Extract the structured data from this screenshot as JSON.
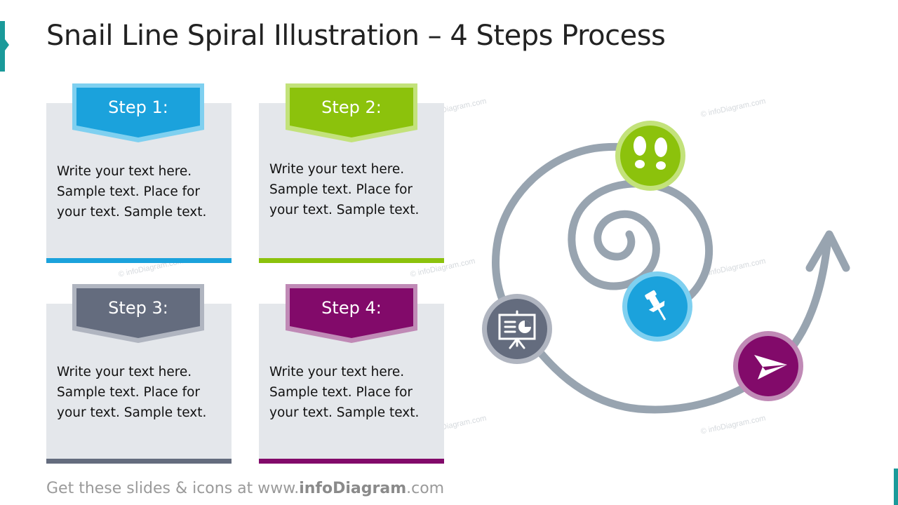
{
  "title": "Snail Line Spiral Illustration – 4 Steps Process",
  "steps": [
    {
      "label": "Step 1:",
      "text_lines": [
        "Write your text here.",
        "Sample text. Place for",
        "your text. Sample text."
      ],
      "color": "#1ba2dc",
      "border_color": "#7fd0f0",
      "icon": "pushpin-icon"
    },
    {
      "label": "Step 2:",
      "text_lines": [
        "Write your text here.",
        "Sample text. Place for",
        "your text. Sample text."
      ],
      "color": "#8cc20c",
      "border_color": "#c3e27b",
      "icon": "footprints-icon"
    },
    {
      "label": "Step 3:",
      "text_lines": [
        "Write your text here.",
        "Sample text. Place for",
        "your text. Sample text."
      ],
      "color": "#646c7e",
      "border_color": "#b0b5c0",
      "icon": "presentation-board-icon"
    },
    {
      "label": "Step 4:",
      "text_lines": [
        "Write your text here.",
        "Sample text. Place for",
        "your text. Sample text."
      ],
      "color": "#820a6a",
      "border_color": "#c08ab6",
      "icon": "paper-plane-icon"
    }
  ],
  "spiral_color": "#98a4b0",
  "watermark_text": "© infoDiagram.com",
  "footer": {
    "prefix": "Get these slides & icons at www.",
    "brand": "infoDiagram",
    "suffix": ".com"
  }
}
